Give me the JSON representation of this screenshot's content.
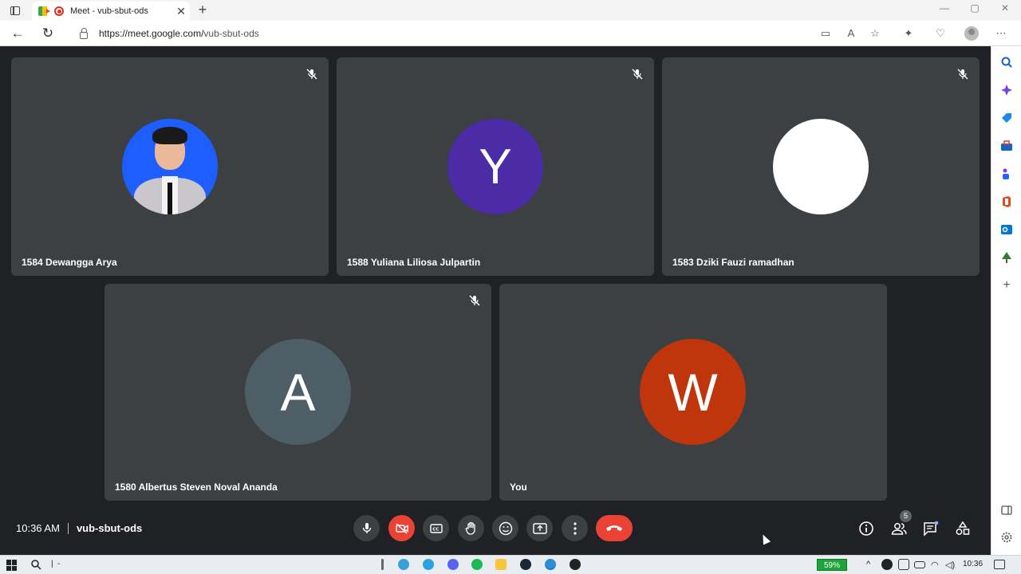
{
  "browser": {
    "tab_title": "Meet - vub-sbut-ods",
    "new_tab_icon": "plus-icon",
    "url_scheme_host": "https://meet.google.com/",
    "url_path": "vub-sbut-ods"
  },
  "participants": [
    {
      "name": "1584 Dewangga Arya",
      "avatar_type": "photo",
      "muted": true
    },
    {
      "name": "1588 Yuliana Liliosa Julpartin",
      "avatar_letter": "Y",
      "avatar_color": "#4c2ba7",
      "muted": true
    },
    {
      "name": "1583 Dziki Fauzi ramadhan",
      "avatar_letter": "",
      "avatar_color": "#ffffff",
      "muted": true
    },
    {
      "name": "1580 Albertus Steven Noval Ananda",
      "avatar_letter": "A",
      "avatar_color": "#4d5e67",
      "muted": true
    },
    {
      "name": "You",
      "avatar_letter": "W",
      "avatar_color": "#bf360c",
      "muted": false
    }
  ],
  "meeting": {
    "time": "10:36 AM",
    "code": "vub-sbut-ods",
    "participant_count": "5"
  },
  "controls": [
    "mic-icon",
    "camera-off-icon",
    "captions-icon",
    "raise-hand-icon",
    "emoji-icon",
    "present-icon",
    "more-options-icon",
    "hang-up-icon"
  ],
  "right_controls": [
    "info-icon",
    "people-icon",
    "chat-icon",
    "activities-icon"
  ],
  "taskbar": {
    "battery": "59%",
    "clock": "10:36",
    "search_separator": "|",
    "dash": "-"
  }
}
